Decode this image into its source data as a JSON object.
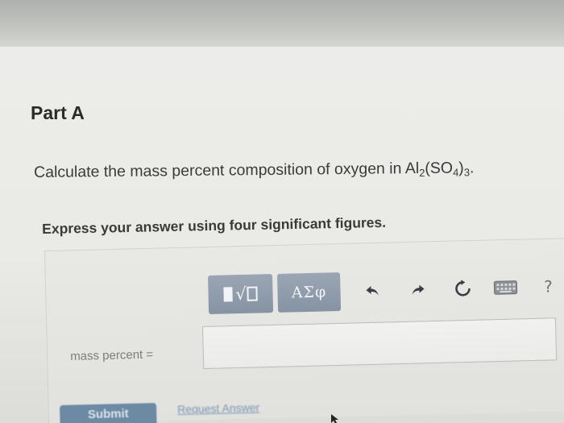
{
  "part": {
    "title": "Part A"
  },
  "question": {
    "prefix": "Calculate the mass percent composition of oxygen in Al",
    "sub1": "2",
    "mid": "(SO",
    "sub2": "4",
    "close": ")",
    "sub3": "3",
    "suffix": "."
  },
  "instruction": "Express your answer using four significant figures.",
  "toolbar": {
    "symbols_label": "ΑΣφ",
    "help_label": "?",
    "icons": [
      "templates-icon",
      "undo-icon",
      "redo-icon",
      "reset-icon",
      "keyboard-icon",
      "help-icon"
    ]
  },
  "answer": {
    "label": "mass percent =",
    "value": ""
  },
  "actions": {
    "submit_label": "Submit",
    "request_label": "Request Answer"
  },
  "colors": {
    "tool_button": "#8e9aaa",
    "submit": "#6c8aa3",
    "link": "#7a96b4",
    "text": "#3a3a3a"
  }
}
